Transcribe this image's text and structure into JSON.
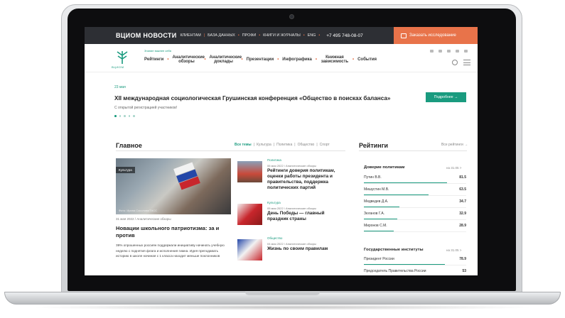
{
  "topbar": {
    "brand": "ВЦИОМ НОВОСТИ",
    "links": [
      "КЛИЕНТАМ",
      "БАЗА ДАННЫХ",
      "ПРОФИ",
      "КНИГИ И ЖУРНАЛЫ",
      "ENG"
    ],
    "phone": "+7 495 748-08-07",
    "order_label": "Заказать исследование"
  },
  "header": {
    "logo_text": "ВЦИОМ",
    "tagline": "Знание важнее себя",
    "nav": [
      "Рейтинги",
      "Аналитические обзоры",
      "Аналитические доклады",
      "Презентации",
      "Инфографика",
      "Книжная зависимость",
      "События"
    ]
  },
  "banner": {
    "date": "23 мая",
    "title": "XII международная социологическая Грушинская конференция «Общество в поисках баланса»",
    "subtitle": "С открытой регистрацией участников!",
    "more_label": "Подробнее →"
  },
  "main": {
    "title": "Главное",
    "filters": [
      "Все темы",
      "Культура",
      "Политика",
      "Общество",
      "Спорт"
    ],
    "featured": {
      "tag": "Культура",
      "caption": "Фото: Ирина Соколова/ТАСС",
      "meta": "31 мая 2022 / Аналитические обзоры",
      "title": "Новации школьного патриотизма: за и против",
      "text": "39% опрошенных россиян поддержали инициативу начинать учебную неделю с поднятия флага и исполнения гимна. Идея преподавать историю в школе начиная с 1 класса находит меньше поклонников"
    },
    "news": [
      {
        "cat": "Политика",
        "meta": "06 мая 2022 / Аналитические обзоры",
        "title": "Рейтинги доверия политикам, оценки работы президента и правительства, поддержка политических партий"
      },
      {
        "cat": "Культура",
        "meta": "05 мая 2022 / Аналитические обзоры",
        "title": "День Победы — главный праздник страны"
      },
      {
        "cat": "Общество",
        "meta": "04 мая 2022 / Аналитические обзоры",
        "title": "Жизнь по своим правилам"
      }
    ]
  },
  "ratings": {
    "title": "Рейтинги",
    "all_label": "Все рейтинги →",
    "groups": [
      {
        "name": "Доверие политикам",
        "date": "на 31.05 >",
        "rows": [
          {
            "name": "Путин В.В.",
            "value": "81.5"
          },
          {
            "name": "Мишустин М.В.",
            "value": "63.5"
          },
          {
            "name": "Медведев Д.А.",
            "value": "34.7"
          },
          {
            "name": "Зюганов Г.А.",
            "value": "32.9"
          },
          {
            "name": "Миронов С.М.",
            "value": "28.9"
          }
        ]
      },
      {
        "name": "Государственные институты",
        "date": "на 31.05 >",
        "rows": [
          {
            "name": "Президент России",
            "value": "78.9"
          },
          {
            "name": "Председатель Правительства России",
            "value": "53"
          }
        ]
      }
    ]
  },
  "colors": {
    "accent": "#1a9b7f",
    "orange": "#e8734a",
    "topbar": "#2d2f34"
  }
}
